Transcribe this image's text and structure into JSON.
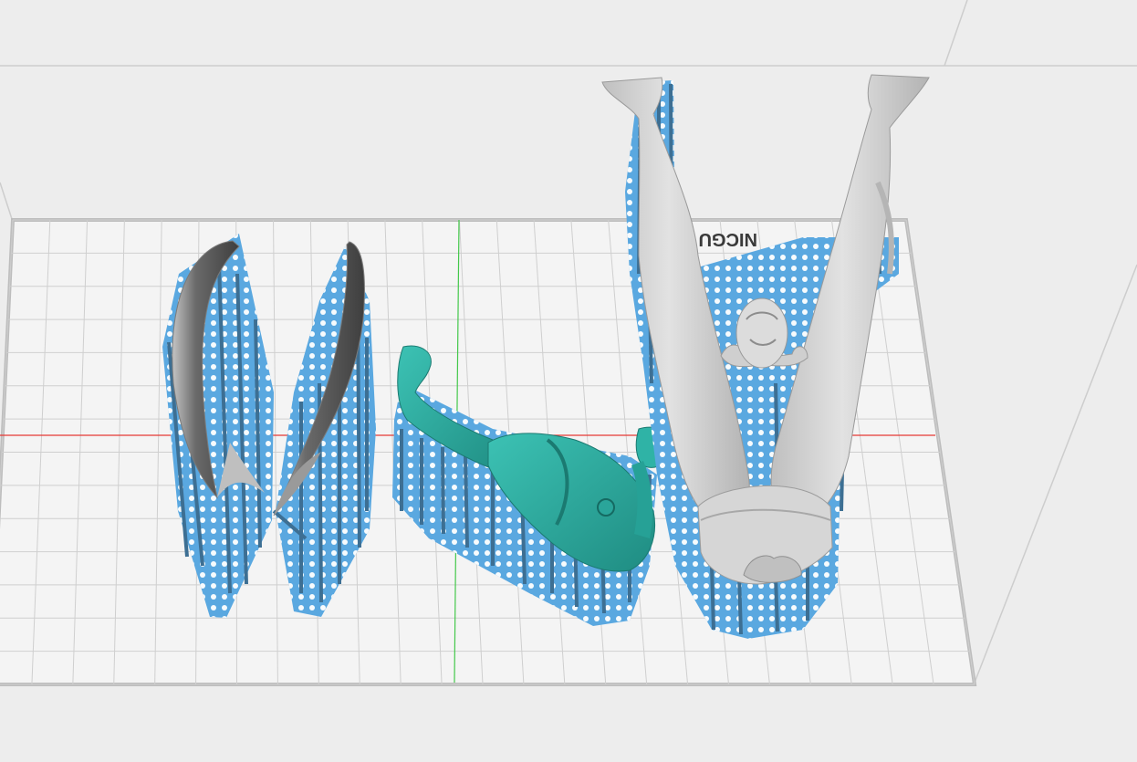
{
  "viewport": {
    "background": "#ededed",
    "grid_line_color": "#c8c8c8",
    "axis_x_color": "#e53935",
    "axis_y_color": "#43c84a"
  },
  "plate": {
    "brand_text": "NICGU",
    "raft_color": "#5aa8e0",
    "support_color": "#3d6f93"
  },
  "models": [
    {
      "name": "horn-left",
      "color": "#5a5a5a"
    },
    {
      "name": "horn-right",
      "color": "#5a5a5a"
    },
    {
      "name": "arm-torso",
      "color": "#2aa59a"
    },
    {
      "name": "legs-figure",
      "color": "#cfcfcf"
    }
  ]
}
